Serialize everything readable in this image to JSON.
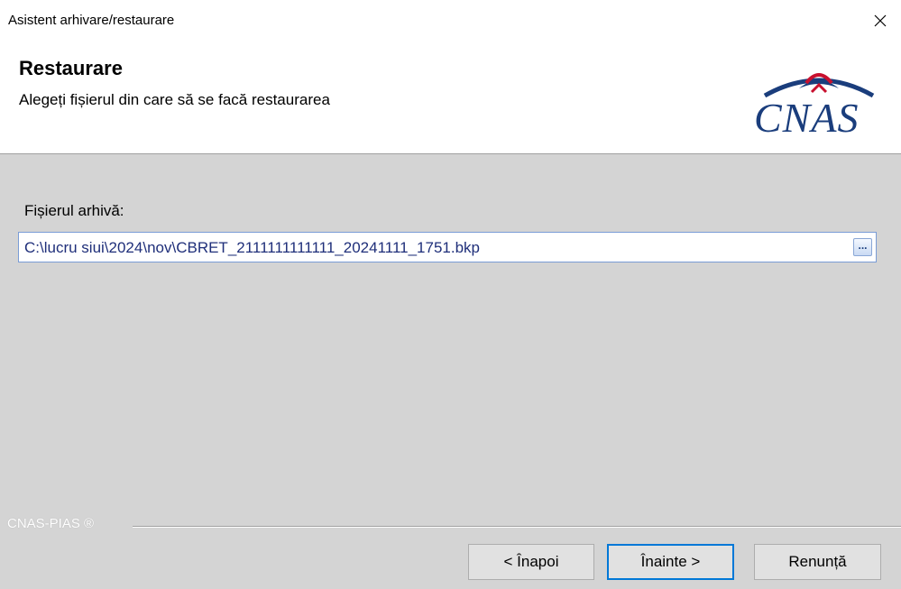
{
  "window": {
    "title": "Asistent arhivare/restaurare"
  },
  "header": {
    "title": "Restaurare",
    "subtitle": "Alegeți fișierul din care să se facă restaurarea",
    "logo_text": "CNAS",
    "logo_color": "#1a3d7c",
    "logo_accent_color": "#c8102e"
  },
  "form": {
    "label": "Fișierul arhivă:",
    "file_value": "C:\\lucru siui\\2024\\nov\\CBRET_2111111111111_20241111_1751.bkp",
    "browse_label": "..."
  },
  "footer": {
    "brand": "CNAS-PIAS ®",
    "back_label": "< Înapoi",
    "next_label": "Înainte >",
    "cancel_label": "Renunță"
  },
  "colors": {
    "content_bg": "#d4d4d4",
    "file_text": "#1f2f7a",
    "primary_border": "#0078d7"
  },
  "icons": {
    "close": "close-icon",
    "logo_arc": "cnas-arc-icon"
  }
}
